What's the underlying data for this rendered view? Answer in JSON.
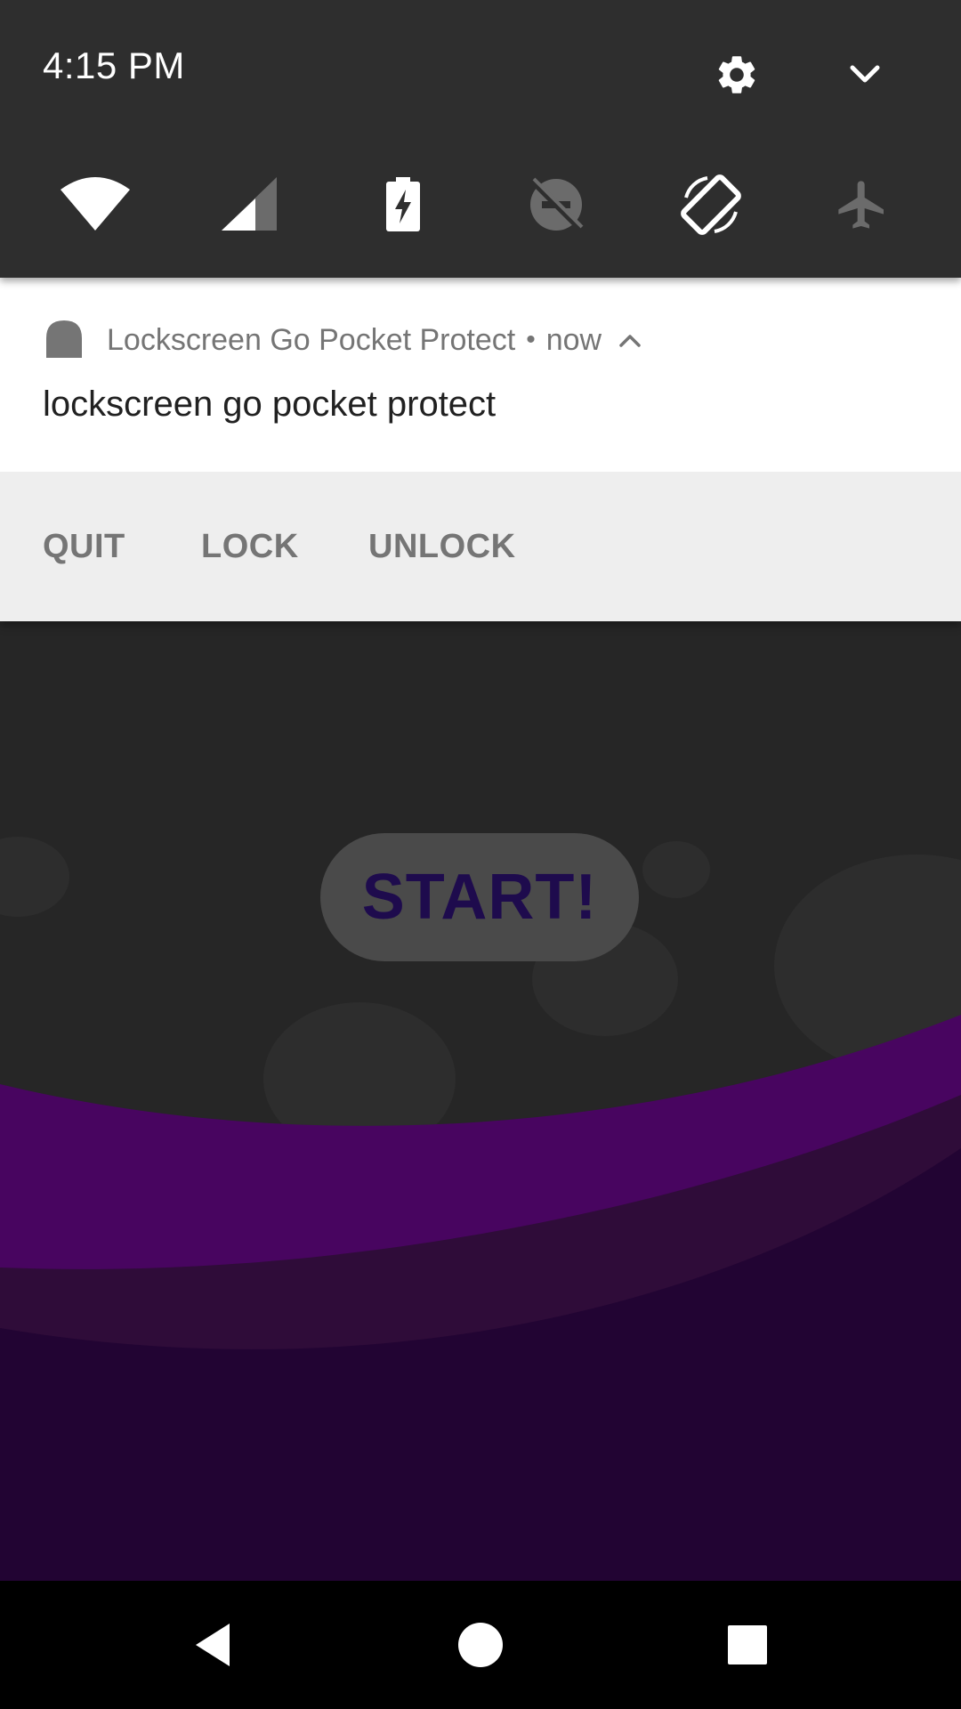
{
  "status": {
    "time": "4:15 PM"
  },
  "quick_settings": {
    "tiles": [
      {
        "name": "wifi-icon",
        "state": "on"
      },
      {
        "name": "cellular-signal-icon",
        "state": "on"
      },
      {
        "name": "battery-saver-icon",
        "state": "on"
      },
      {
        "name": "do-not-disturb-icon",
        "state": "off"
      },
      {
        "name": "auto-rotate-icon",
        "state": "on"
      },
      {
        "name": "airplane-mode-icon",
        "state": "off"
      }
    ]
  },
  "notification": {
    "app_name": "Lockscreen Go Pocket Protect",
    "separator": "•",
    "time": "now",
    "text": "lockscreen go pocket protect",
    "actions": {
      "quit": "QUIT",
      "lock": "LOCK",
      "unlock": "UNLOCK"
    }
  },
  "app": {
    "start_label": "START!"
  },
  "colors": {
    "shade_bg": "#2e2e2e",
    "app_bg": "#262626",
    "purple_wave": "#480560",
    "purple_mid": "#2f0c39",
    "purple_dark": "#220433",
    "start_text": "#1e0b4d"
  }
}
